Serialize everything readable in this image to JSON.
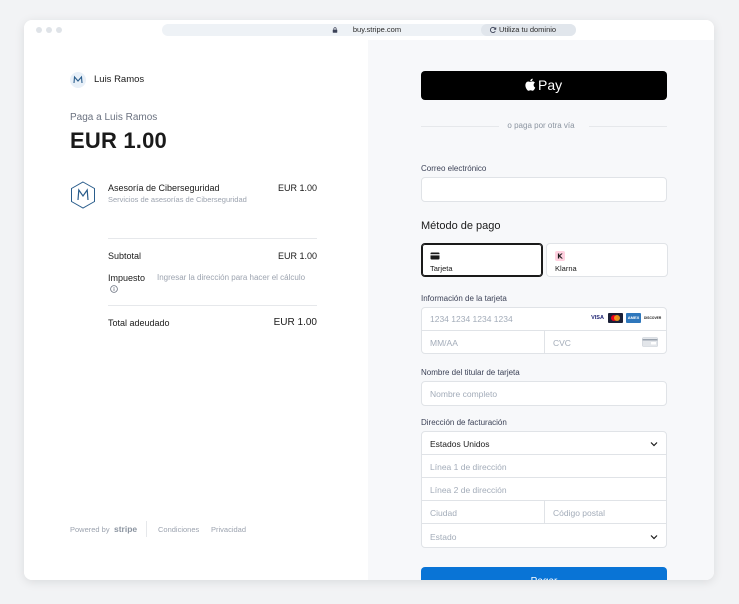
{
  "browser": {
    "url": "buy.stripe.com",
    "domain_chip": "Utiliza tu dominio"
  },
  "summary": {
    "merchant_name": "Luis Ramos",
    "pay_to": "Paga a Luis Ramos",
    "amount": "EUR 1.00",
    "product": {
      "name": "Asesoría de Ciberseguridad",
      "description": "Servicios de asesorías de Ciberseguridad",
      "price": "EUR 1.00"
    },
    "subtotal_label": "Subtotal",
    "subtotal_value": "EUR 1.00",
    "tax_label": "Impuesto",
    "tax_note": "Ingresar la dirección para hacer el cálculo",
    "total_label": "Total adeudado",
    "total_value": "EUR 1.00"
  },
  "footer": {
    "powered_by": "Powered by",
    "stripe": "stripe",
    "terms": "Condiciones",
    "privacy": "Privacidad"
  },
  "checkout": {
    "applepay_label": "Pay",
    "divider_text": "o paga por otra vía",
    "email_label": "Correo electrónico",
    "payment_method_title": "Método de pago",
    "methods": [
      {
        "label": "Tarjeta"
      },
      {
        "label": "Klarna"
      }
    ],
    "card_info_label": "Información de la tarjeta",
    "card_number_placeholder": "1234 1234 1234 1234",
    "expiry_placeholder": "MM/AA",
    "cvc_placeholder": "CVC",
    "card_brands": [
      "VISA",
      "Mastercard",
      "AMEX",
      "DISCOVER"
    ],
    "cardholder_label": "Nombre del titular de tarjeta",
    "cardholder_placeholder": "Nombre completo",
    "billing_label": "Dirección de facturación",
    "country_value": "Estados Unidos",
    "address1_placeholder": "Línea 1 de dirección",
    "address2_placeholder": "Línea 2 de dirección",
    "city_placeholder": "Ciudad",
    "postal_placeholder": "Código postal",
    "state_placeholder": "Estado",
    "pay_button": "Pagar"
  },
  "colors": {
    "pay_button": "#0974d6",
    "applepay_bg": "#000000",
    "right_panel_bg": "#f7f8fa"
  }
}
